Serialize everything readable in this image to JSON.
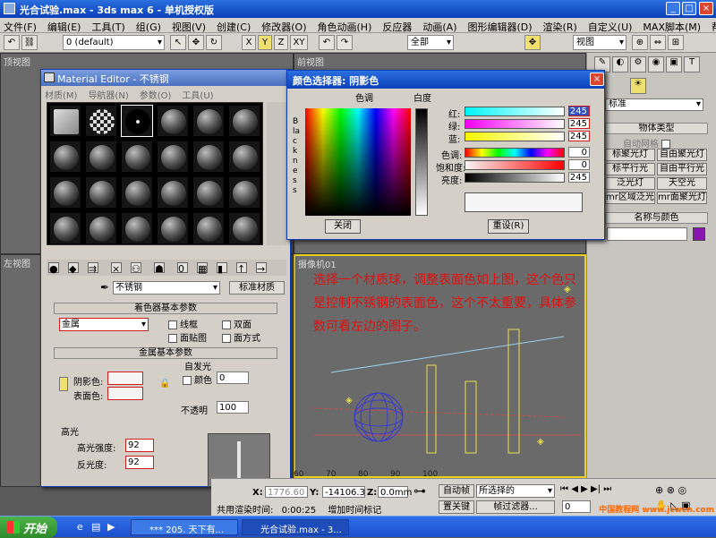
{
  "window": {
    "title": "光合试验.max - 3ds max 6 - 单机授权版"
  },
  "menu": [
    "文件(F)",
    "编辑(E)",
    "工具(T)",
    "组(G)",
    "视图(V)",
    "创建(C)",
    "修改器(O)",
    "角色动画(H)",
    "反应器",
    "动画(A)",
    "图形编辑器(D)",
    "渲染(R)",
    "自定义(U)",
    "MAX脚本(M)",
    "帮助(H)"
  ],
  "toolbar": {
    "selection_set": "0 (default)",
    "filter": "全部",
    "ref_coord": "视图",
    "axis_x": "X",
    "axis_y": "Y",
    "axis_z": "Z",
    "axis_xy": "XY"
  },
  "viewports": {
    "top": "顶视图",
    "front": "前视图",
    "left": "左视图",
    "camera": "摄像机01"
  },
  "material_editor": {
    "title": "Material Editor - 不锈钢",
    "menu": [
      "材质(M)",
      "导航器(N)",
      "参数(O)",
      "工具(U)"
    ],
    "material_name": "不锈钢",
    "material_type": "标准材质",
    "shader_rollout": "着色器基本参数",
    "shader": "金属",
    "wire": "线框",
    "two_sided": "双面",
    "face_map": "面贴图",
    "faceted": "面方式",
    "metal_rollout": "金属基本参数",
    "self_illum": "自发光",
    "color": "颜色",
    "self_illum_value": "0",
    "ambient": "阴影色:",
    "diffuse": "表面色:",
    "opacity_label": "不透明",
    "opacity": "100",
    "specular_section": "高光",
    "spec_level_label": "高光强度:",
    "spec_level": "92",
    "gloss_label": "反光度:",
    "gloss": "92"
  },
  "color_picker": {
    "title": "颜色选择器: 阴影色",
    "hue_label": "色调",
    "white_label": "白度",
    "blackness": "Blackness",
    "red_label": "红:",
    "red": "245",
    "green_label": "绿:",
    "green": "245",
    "blue_label": "蓝:",
    "blue": "245",
    "hue_label2": "色调:",
    "hue": "0",
    "sat_label": "饱和度:",
    "sat": "0",
    "value_label": "亮度:",
    "value": "245",
    "close_btn": "关闭",
    "reset_btn": "重设(R)"
  },
  "command_panel": {
    "dropdown": "标准",
    "object_type": "物体类型",
    "auto_grid": "自动网格",
    "lights": [
      "标聚光灯",
      "自由聚光灯",
      "标平行光",
      "自由平行光",
      "泛光灯",
      "天空光",
      "mr区域泛光灯",
      "mr面聚光灯"
    ],
    "name_color": "名称与颜色"
  },
  "annotation": "选择一个材质球，调整表面色如上图，这个色只是控制不锈钢的表面色，这个不太重要，具体参数可看左边的图子。",
  "status": {
    "x": "1776.60",
    "y": "-14106.3",
    "z": "0.0mm",
    "auto_key": "自动帧",
    "selected": "所选择的",
    "set_key": "置关键",
    "key_filters": "帧过滤器...",
    "render_time_label": "共用渲染时间:",
    "render_time": "0:00:25",
    "add_time_tag": "增加时间标记",
    "timeline_ticks": [
      "60",
      "70",
      "80",
      "90",
      "100"
    ],
    "frame": "0"
  },
  "taskbar": {
    "start": "开始",
    "tasks": [
      "*** 205. 天下有...",
      "光合试验.max - 3..."
    ]
  },
  "watermark": "中国教程网 www.jcwcn.com",
  "colors": {
    "title_blue": "#0a3fb8",
    "annot_red": "#e01010",
    "wire_yellow": "#e8e04a",
    "sphere_blue": "#3a3ad0"
  }
}
